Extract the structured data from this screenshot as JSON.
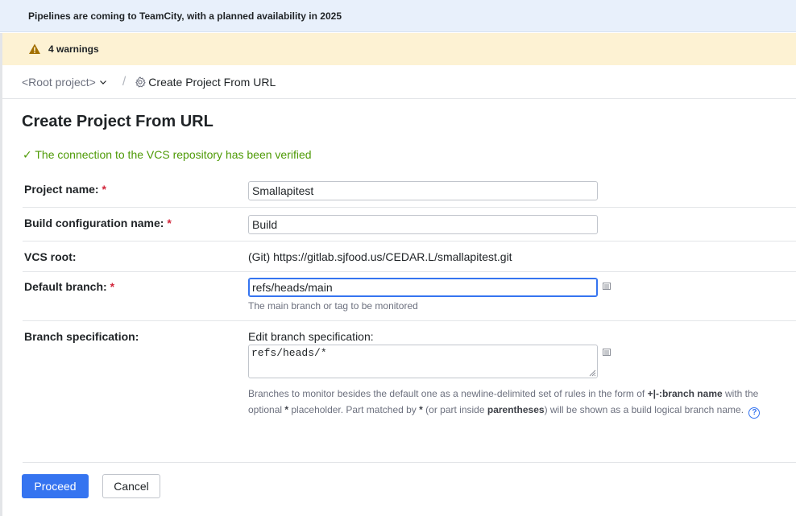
{
  "banners": {
    "info_text": "Pipelines are coming to TeamCity, with a planned availability in 2025",
    "warning_text": "4 warnings"
  },
  "breadcrumb": {
    "root": "<Root project>",
    "separator": "/",
    "current": "Create Project From URL"
  },
  "page": {
    "title": "Create Project From URL",
    "verified_message": "✓ The connection to the VCS repository has been verified"
  },
  "form": {
    "project_name": {
      "label": "Project name:",
      "required_mark": "*",
      "value": "Smallapitest"
    },
    "build_config_name": {
      "label": "Build configuration name:",
      "required_mark": "*",
      "value": "Build"
    },
    "vcs_root": {
      "label": "VCS root:",
      "value": "(Git) https://gitlab.sjfood.us/CEDAR.L/smallapitest.git"
    },
    "default_branch": {
      "label": "Default branch:",
      "required_mark": "*",
      "value": "refs/heads/main",
      "hint": "The main branch or tag to be monitored"
    },
    "branch_spec": {
      "label": "Branch specification:",
      "edit_label": "Edit branch specification:",
      "value": "refs/heads/*",
      "desc_part1": "Branches to monitor besides the default one as a newline-delimited set of rules in the form of ",
      "desc_bold1": "+|-:branch name",
      "desc_part2": " with the optional ",
      "desc_bold2": "*",
      "desc_part3": " placeholder. Part matched by ",
      "desc_bold3": "*",
      "desc_part4": " (or part inside ",
      "desc_bold4": "parentheses",
      "desc_part5": ") will be shown as a build logical branch name.",
      "help_glyph": "?"
    }
  },
  "buttons": {
    "proceed": "Proceed",
    "cancel": "Cancel"
  },
  "colors": {
    "accent": "#3574f0",
    "success": "#4e9a06",
    "required": "#d1263b",
    "warning_bg": "#fdf2d3",
    "info_bg": "#e8f0fb"
  },
  "icons": {
    "warning": "warning-triangle-icon",
    "chevron": "chevron-down-icon",
    "gear": "gear-icon",
    "editor": "text-editor-icon",
    "help": "help-icon"
  }
}
